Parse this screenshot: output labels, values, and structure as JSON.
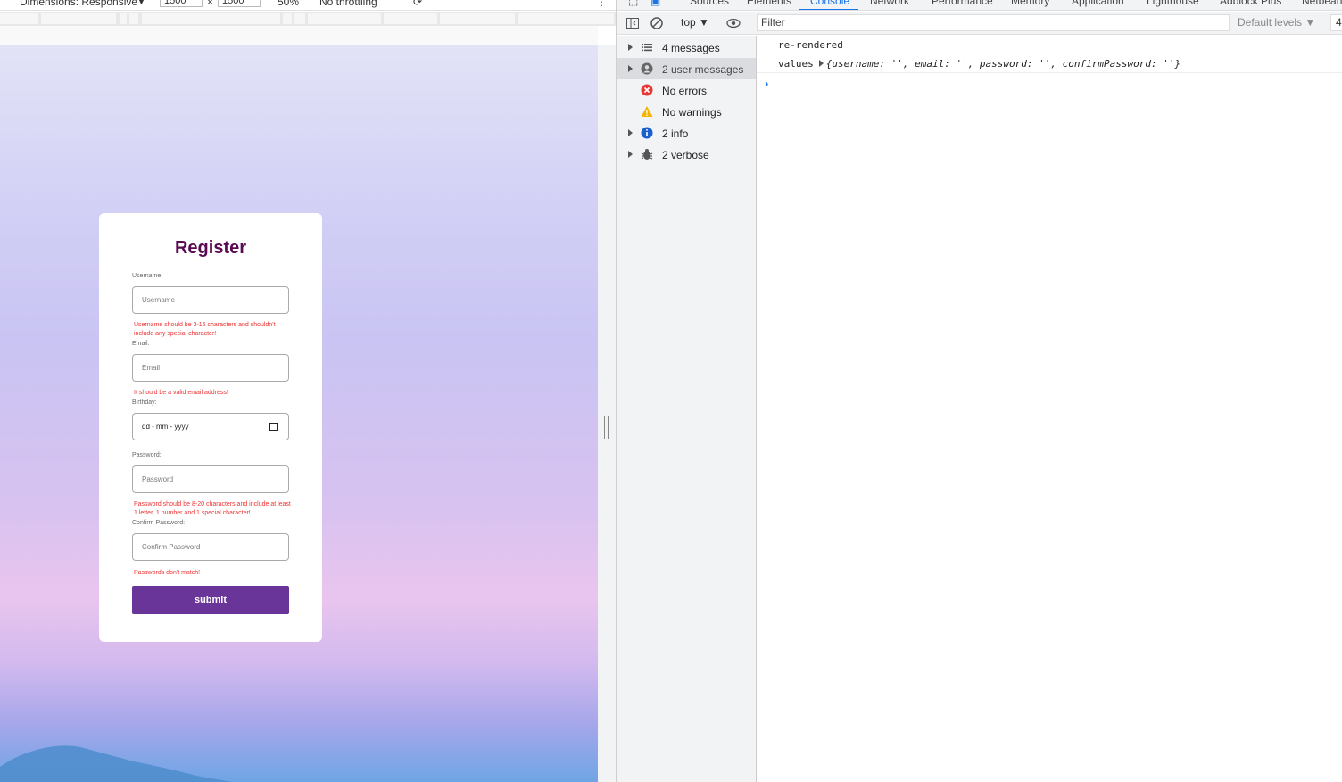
{
  "device_toolbar": {
    "dimensions_label": "Dimensions: Responsive",
    "width_value": "1500",
    "times": "×",
    "height_value": "1500",
    "zoom": "50%",
    "throttle": "No throttling"
  },
  "register": {
    "title": "Register",
    "fields": [
      {
        "label": "Username:",
        "placeholder": "Username",
        "error": "Username should be 3-16 characters and shouldn't include any special character!"
      },
      {
        "label": "Email:",
        "placeholder": "Email",
        "error": "It should be a valid email address!"
      },
      {
        "label": "Birthday:",
        "placeholder": "dd - mm - yyyy",
        "error": ""
      },
      {
        "label": "Password:",
        "placeholder": "Password",
        "error": "Password should be 8-20 characters and include at least 1 letter, 1 number and 1 special character!"
      },
      {
        "label": "Confirm Password:",
        "placeholder": "Confirm Password",
        "error": "Passwords don't match!"
      }
    ],
    "submit_label": "submit"
  },
  "devtools": {
    "tabs": [
      "Sources",
      "Elements",
      "Console",
      "Network",
      "Performance",
      "Memory",
      "Application",
      "Lighthouse",
      "Adblock Plus",
      "Netbeans"
    ],
    "active_tab": "Console",
    "toolbar": {
      "context": "top ▼",
      "filter_placeholder": "Filter",
      "levels": "Default levels ▼",
      "issues_count": "4"
    },
    "sidebar": [
      {
        "label": "4 messages",
        "icon": "list-icon",
        "expandable": true
      },
      {
        "label": "2 user messages",
        "icon": "user-icon",
        "expandable": true
      },
      {
        "label": "No errors",
        "icon": "error-icon",
        "expandable": false
      },
      {
        "label": "No warnings",
        "icon": "warning-icon",
        "expandable": false
      },
      {
        "label": "2 info",
        "icon": "info-icon",
        "expandable": true
      },
      {
        "label": "2 verbose",
        "icon": "bug-icon",
        "expandable": true
      }
    ],
    "logs": [
      {
        "text": "re-rendered"
      },
      {
        "prefix": "values",
        "object": "{username: '', email: '', password: '', confirmPassword: ''}"
      }
    ],
    "prompt": "›"
  }
}
